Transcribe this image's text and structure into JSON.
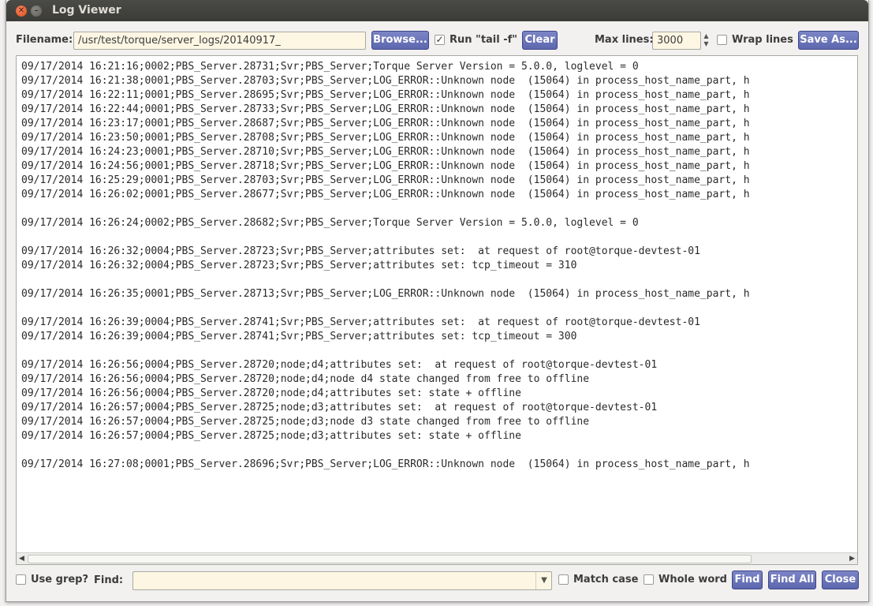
{
  "window": {
    "title": "Log Viewer"
  },
  "toolbar": {
    "filename_label": "Filename:",
    "filename_value": "/usr/test/torque/server_logs/20140917_",
    "browse_label": "Browse...",
    "tail_label": "Run \"tail -f\"",
    "tail_checked": true,
    "clear_label": "Clear",
    "maxlines_label": "Max lines:",
    "maxlines_value": "3000",
    "wrap_label": "Wrap lines",
    "wrap_checked": false,
    "saveas_label": "Save As..."
  },
  "log": {
    "lines": [
      "09/17/2014 16:21:16;0002;PBS_Server.28731;Svr;PBS_Server;Torque Server Version = 5.0.0, loglevel = 0",
      "09/17/2014 16:21:38;0001;PBS_Server.28703;Svr;PBS_Server;LOG_ERROR::Unknown node  (15064) in process_host_name_part, h",
      "09/17/2014 16:22:11;0001;PBS_Server.28695;Svr;PBS_Server;LOG_ERROR::Unknown node  (15064) in process_host_name_part, h",
      "09/17/2014 16:22:44;0001;PBS_Server.28733;Svr;PBS_Server;LOG_ERROR::Unknown node  (15064) in process_host_name_part, h",
      "09/17/2014 16:23:17;0001;PBS_Server.28687;Svr;PBS_Server;LOG_ERROR::Unknown node  (15064) in process_host_name_part, h",
      "09/17/2014 16:23:50;0001;PBS_Server.28708;Svr;PBS_Server;LOG_ERROR::Unknown node  (15064) in process_host_name_part, h",
      "09/17/2014 16:24:23;0001;PBS_Server.28710;Svr;PBS_Server;LOG_ERROR::Unknown node  (15064) in process_host_name_part, h",
      "09/17/2014 16:24:56;0001;PBS_Server.28718;Svr;PBS_Server;LOG_ERROR::Unknown node  (15064) in process_host_name_part, h",
      "09/17/2014 16:25:29;0001;PBS_Server.28703;Svr;PBS_Server;LOG_ERROR::Unknown node  (15064) in process_host_name_part, h",
      "09/17/2014 16:26:02;0001;PBS_Server.28677;Svr;PBS_Server;LOG_ERROR::Unknown node  (15064) in process_host_name_part, h",
      "",
      "09/17/2014 16:26:24;0002;PBS_Server.28682;Svr;PBS_Server;Torque Server Version = 5.0.0, loglevel = 0",
      "",
      "09/17/2014 16:26:32;0004;PBS_Server.28723;Svr;PBS_Server;attributes set:  at request of root@torque-devtest-01",
      "09/17/2014 16:26:32;0004;PBS_Server.28723;Svr;PBS_Server;attributes set: tcp_timeout = 310",
      "",
      "09/17/2014 16:26:35;0001;PBS_Server.28713;Svr;PBS_Server;LOG_ERROR::Unknown node  (15064) in process_host_name_part, h",
      "",
      "09/17/2014 16:26:39;0004;PBS_Server.28741;Svr;PBS_Server;attributes set:  at request of root@torque-devtest-01",
      "09/17/2014 16:26:39;0004;PBS_Server.28741;Svr;PBS_Server;attributes set: tcp_timeout = 300",
      "",
      "09/17/2014 16:26:56;0004;PBS_Server.28720;node;d4;attributes set:  at request of root@torque-devtest-01",
      "09/17/2014 16:26:56;0004;PBS_Server.28720;node;d4;node d4 state changed from free to offline",
      "09/17/2014 16:26:56;0004;PBS_Server.28720;node;d4;attributes set: state + offline",
      "09/17/2014 16:26:57;0004;PBS_Server.28725;node;d3;attributes set:  at request of root@torque-devtest-01",
      "09/17/2014 16:26:57;0004;PBS_Server.28725;node;d3;node d3 state changed from free to offline",
      "09/17/2014 16:26:57;0004;PBS_Server.28725;node;d3;attributes set: state + offline",
      "",
      "09/17/2014 16:27:08;0001;PBS_Server.28696;Svr;PBS_Server;LOG_ERROR::Unknown node  (15064) in process_host_name_part, h"
    ]
  },
  "findbar": {
    "grep_label": "Use grep?",
    "grep_checked": false,
    "find_label": "Find:",
    "find_value": "",
    "matchcase_label": "Match case",
    "matchcase_checked": false,
    "wholeword_label": "Whole word",
    "wholeword_checked": false,
    "find_button": "Find",
    "findall_button": "Find All",
    "close_button": "Close"
  },
  "icons": {
    "close": "close-icon",
    "minimize": "minimize-icon",
    "spin": "spin-arrows-icon",
    "combo": "chevron-down-icon",
    "scroll_left": "arrow-left-icon",
    "scroll_right": "arrow-right-icon"
  },
  "colors": {
    "button_bg": "#6670b8",
    "entry_bg": "#fdf6e3",
    "titlebar_bg": "#3c3b37",
    "close_button": "#df4a16"
  }
}
